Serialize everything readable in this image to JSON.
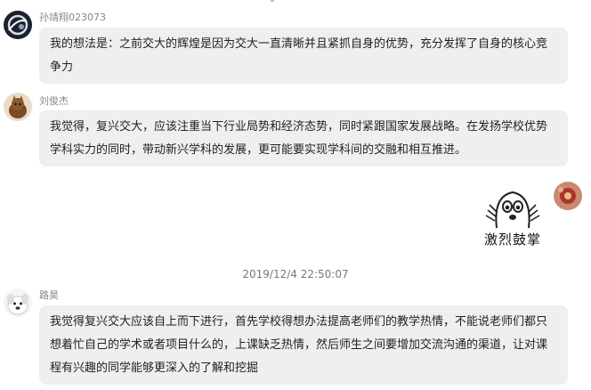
{
  "messages": [
    {
      "sender": "孙靖翔023073",
      "text": "我的想法是：之前交大的辉煌是因为交大一直清晰并且紧抓自身的优势，充分发挥了自身的核心竞争力",
      "avatar": "dark-swirl-avatar"
    },
    {
      "sender": "刘俊杰",
      "text": "我觉得，复兴交大，应该注重当下行业局势和经济态势，同时紧跟国家发展战略。在发扬学校优势学科实力的同时，带动新兴学科的发展，更可能要实现学科间的交融和相互推进。",
      "avatar": "brown-cat-avatar"
    },
    {
      "sender": "",
      "sticker_caption": "激烈鼓掌",
      "avatar": "red-flower-avatar",
      "self": true
    }
  ],
  "timestamp": "2019/12/4 22:50:07",
  "last_message": {
    "sender": "路昊",
    "text": "我觉得复兴交大应该自上而下进行，首先学校得想办法提高老师们的教学热情，不能说老师们都只想着忙自己的学术或者项目什么的，上课缺乏热情，然后师生之间要增加交流沟通的渠道，让对课程有兴趣的同学能够更深入的了解和挖掘",
    "avatar": "white-dog-avatar"
  },
  "colors": {
    "bubble_bg": "#efefef",
    "nickname": "#888888",
    "text": "#222222"
  }
}
